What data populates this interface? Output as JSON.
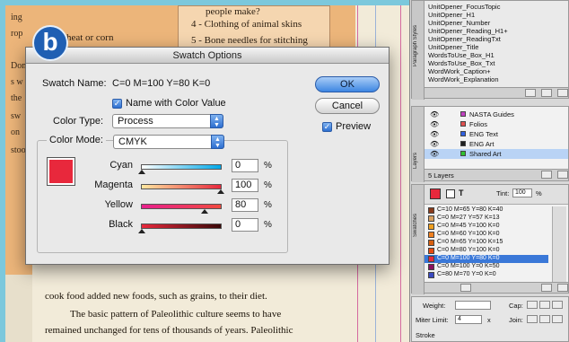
{
  "badge": "b",
  "document": {
    "box_lines": [
      "4 - Clothing of animal skins",
      "5 - Bone needles for stitching",
      "people make?"
    ],
    "edge_words": [
      "ing",
      "rop",
      "Don",
      "s w",
      "the",
      "sw",
      "on",
      "stoo"
    ],
    "left_frag": "wheat or corn",
    "body_lines": [
      "cook food added new foods, such as grains, to their diet.",
      "The basic pattern of Paleolithic culture seems to have",
      "remained unchanged for tens of thousands of years. Paleolithic"
    ]
  },
  "dialog": {
    "title": "Swatch Options",
    "swatch_name_label": "Swatch Name:",
    "swatch_name_value": "C=0 M=100 Y=80 K=0",
    "name_with_color_value_label": "Name with Color Value",
    "name_with_color_value_checked": true,
    "color_type_label": "Color Type:",
    "color_type_value": "Process",
    "color_mode_label": "Color Mode:",
    "color_mode_value": "CMYK",
    "ok_label": "OK",
    "cancel_label": "Cancel",
    "preview_label": "Preview",
    "preview_checked": true,
    "preview_color": "#e8283c",
    "sliders": [
      {
        "label": "Cyan",
        "value": "0",
        "unit": "%",
        "level": 0
      },
      {
        "label": "Magenta",
        "value": "100",
        "unit": "%",
        "level": 100
      },
      {
        "label": "Yellow",
        "value": "80",
        "unit": "%",
        "level": 80
      },
      {
        "label": "Black",
        "value": "0",
        "unit": "%",
        "level": 0
      }
    ]
  },
  "paragraph_styles": {
    "tab_label": "Paragraph Styles",
    "items": [
      "UnitOpener_FocusTopic",
      "UnitOpener_H1",
      "UnitOpener_Number",
      "UnitOpener_Reading_H1+",
      "UnitOpener_ReadingTxt",
      "UnitOpener_Title",
      "WordsToUse_Box_H1",
      "WordsToUse_Box_Txt",
      "WordWork_Caption+",
      "WordWork_Explanation"
    ]
  },
  "layers": {
    "tab_label": "Layers",
    "items": [
      {
        "name": "NASTA Guides",
        "color": "#c040c0"
      },
      {
        "name": "Folios",
        "color": "#e05050"
      },
      {
        "name": "ENG Text",
        "color": "#3060e0"
      },
      {
        "name": "ENG Art",
        "color": "#202020"
      },
      {
        "name": "Shared Art",
        "color": "#30c030"
      }
    ],
    "count_label": "5 Layers"
  },
  "swatches": {
    "tab_label": "Swatches",
    "tint_label": "Tint:",
    "tint_value": "100",
    "tint_unit": "%",
    "items": [
      {
        "name": "C=10 M=65 Y=80 K=40",
        "color": "#8a3a1a"
      },
      {
        "name": "C=0 M=27 Y=57 K=13",
        "color": "#d8a060"
      },
      {
        "name": "C=0 M=45 Y=100 K=0",
        "color": "#f0a020"
      },
      {
        "name": "C=0 M=60 Y=100 K=0",
        "color": "#f08020"
      },
      {
        "name": "C=0 M=65 Y=100 K=15",
        "color": "#d86010"
      },
      {
        "name": "C=0 M=80 Y=100 K=0",
        "color": "#e84a10"
      },
      {
        "name": "C=0 M=100 Y=80 K=0",
        "color": "#e8283c"
      },
      {
        "name": "C=0 M=100 Y=0 K=50",
        "color": "#8a1060"
      },
      {
        "name": "C=80 M=70 Y=0 K=0",
        "color": "#3a4ac0"
      }
    ],
    "selected_index": 6
  },
  "stroke": {
    "weight_label": "Weight:",
    "cap_label": "Cap:",
    "miter_label": "Miter Limit:",
    "miter_value": "4",
    "join_label": "Join:",
    "x_label": "x",
    "other_label": "Stroke"
  }
}
